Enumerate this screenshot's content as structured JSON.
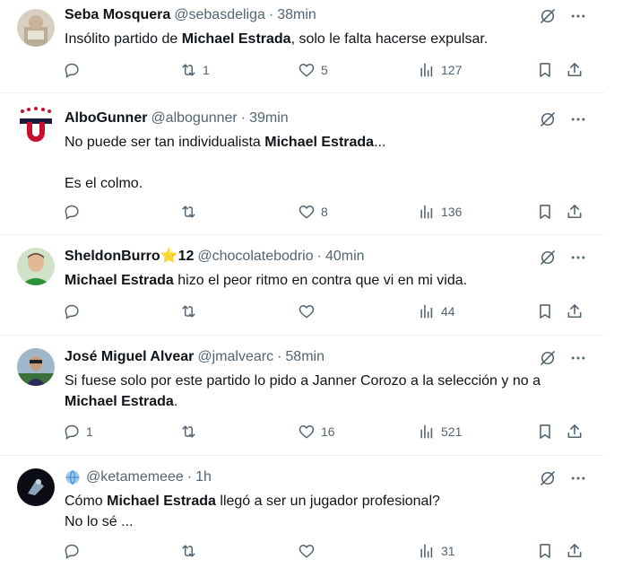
{
  "highlight": "Michael Estrada",
  "tweets": [
    {
      "name": "Seba Mosquera",
      "handle": "@sebasdeliga",
      "time": "38min",
      "text_pre": "Insólito partido de ",
      "text_post": ", solo le falta hacerse expulsar.",
      "replies": "",
      "retweets": "1",
      "likes": "5",
      "views": "127"
    },
    {
      "name": "AlboGunner",
      "handle": "@albogunner",
      "time": "39min",
      "text_pre": "No puede ser tan individualista ",
      "text_post": "...\n\nEs el colmo.",
      "replies": "",
      "retweets": "",
      "likes": "8",
      "views": "136"
    },
    {
      "name": "SheldonBurro⭐12",
      "handle": "@chocolatebodrio",
      "time": "40min",
      "text_pre": "",
      "text_post": " hizo el peor ritmo en contra que vi en mi vida.",
      "replies": "",
      "retweets": "",
      "likes": "",
      "views": "44"
    },
    {
      "name": "José Miguel Alvear",
      "handle": "@jmalvearc",
      "time": "58min",
      "text_pre": "Si fuese solo por este partido lo pido a Janner Corozo a la selección y no a ",
      "text_post": ".",
      "replies": "1",
      "retweets": "",
      "likes": "16",
      "views": "521"
    },
    {
      "name": "",
      "handle": "@ketamemeee",
      "time": "1h",
      "text_pre": "Cómo ",
      "text_post": " llegó a ser un jugador profesional?\nNo lo sé ...",
      "replies": "",
      "retweets": "",
      "likes": "",
      "views": "31"
    }
  ],
  "icons": {
    "reply": "reply-icon",
    "retweet": "retweet-icon",
    "like": "heart-icon",
    "views": "views-icon",
    "bookmark": "bookmark-icon",
    "share": "share-icon",
    "grok": "grok-icon",
    "more": "more-icon",
    "globe": "globe-icon"
  },
  "colors": {
    "text": "#0f1419",
    "secondary": "#536471",
    "divider": "#eff3f4"
  }
}
